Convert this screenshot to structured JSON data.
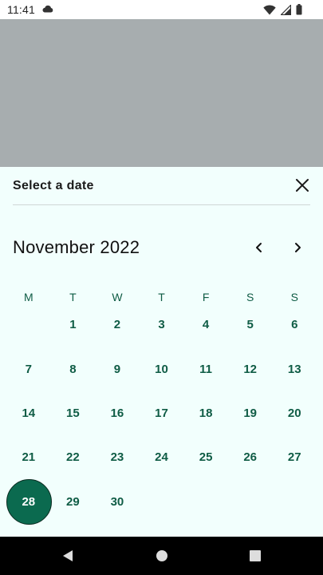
{
  "status_bar": {
    "time": "11:41",
    "icons": [
      "cloud-icon",
      "wifi-icon",
      "signal-icon",
      "battery-icon"
    ]
  },
  "sheet": {
    "title": "Select a date",
    "close_icon": "close-icon"
  },
  "calendar": {
    "month_label": "November 2022",
    "prev_icon": "chevron-left-icon",
    "next_icon": "chevron-right-icon",
    "weekdays": [
      "M",
      "T",
      "W",
      "T",
      "F",
      "S",
      "S"
    ],
    "weeks": [
      [
        "",
        "1",
        "2",
        "3",
        "4",
        "5",
        "6"
      ],
      [
        "7",
        "8",
        "9",
        "10",
        "11",
        "12",
        "13"
      ],
      [
        "14",
        "15",
        "16",
        "17",
        "18",
        "19",
        "20"
      ],
      [
        "21",
        "22",
        "23",
        "24",
        "25",
        "26",
        "27"
      ],
      [
        "28",
        "29",
        "30",
        "",
        "",
        "",
        ""
      ]
    ],
    "selected_day": "28"
  },
  "colors": {
    "accent": "#0b6a4f",
    "day_text": "#0f5c45",
    "sheet_bg": "#f2fffd",
    "scrim": "#a7adaf"
  },
  "nav_bar": {
    "icons": [
      "back-icon",
      "home-icon",
      "recents-icon"
    ]
  }
}
